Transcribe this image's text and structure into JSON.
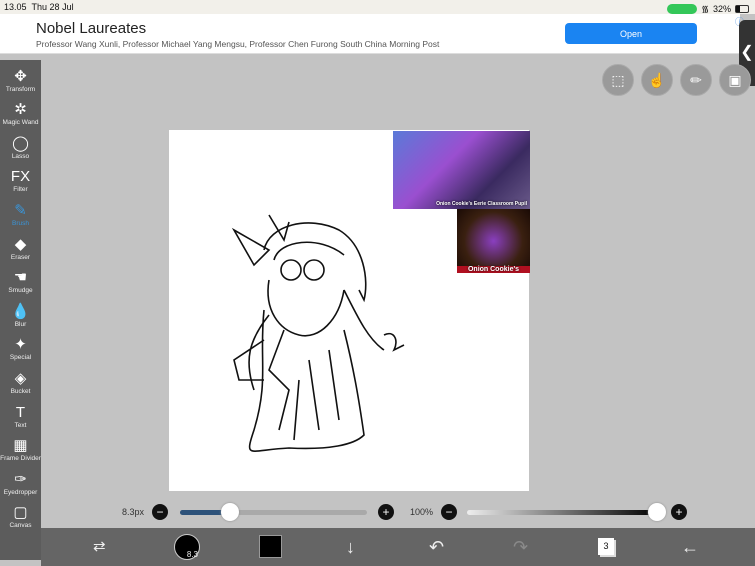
{
  "status": {
    "time": "13.05",
    "date": "Thu 28 Jul",
    "battery": "32%"
  },
  "ad": {
    "title": "Nobel Laureates",
    "subtitle": "Professor Wang Xunli, Professor Michael Yang Mengsu, Professor Chen Furong South China Morning Post",
    "button": "Open"
  },
  "tools": [
    {
      "name": "transform",
      "label": "Transform",
      "icon": "✥"
    },
    {
      "name": "magic-wand",
      "label": "Magic Wand",
      "icon": "✲"
    },
    {
      "name": "lasso",
      "label": "Lasso",
      "icon": "◯"
    },
    {
      "name": "filter",
      "label": "Filter",
      "icon": "FX"
    },
    {
      "name": "brush",
      "label": "Brush",
      "icon": "✎"
    },
    {
      "name": "eraser",
      "label": "Eraser",
      "icon": "◆"
    },
    {
      "name": "smudge",
      "label": "Smudge",
      "icon": "☚"
    },
    {
      "name": "blur",
      "label": "Blur",
      "icon": "💧"
    },
    {
      "name": "special",
      "label": "Special",
      "icon": "✦"
    },
    {
      "name": "bucket",
      "label": "Bucket",
      "icon": "◈"
    },
    {
      "name": "text",
      "label": "Text",
      "icon": "T"
    },
    {
      "name": "frame-divider",
      "label": "Frame Divider",
      "icon": "▦"
    },
    {
      "name": "eyedropper",
      "label": "Eyedropper",
      "icon": "✑"
    },
    {
      "name": "canvas",
      "label": "Canvas",
      "icon": "▢"
    }
  ],
  "active_tool": "Brush",
  "references": {
    "ref1_caption": "Onion Cookie's Eerie Classroom Pupil",
    "ref2_caption": "Onion Cookie's"
  },
  "brush": {
    "size_label": "8.3px",
    "size_fraction": 0.27,
    "opacity_label": "100%",
    "opacity_fraction": 1.0,
    "badge": "8.3"
  },
  "layers": {
    "count": "3"
  },
  "colors": {
    "accent": "#3a95d8",
    "primary_color": "#000000"
  }
}
